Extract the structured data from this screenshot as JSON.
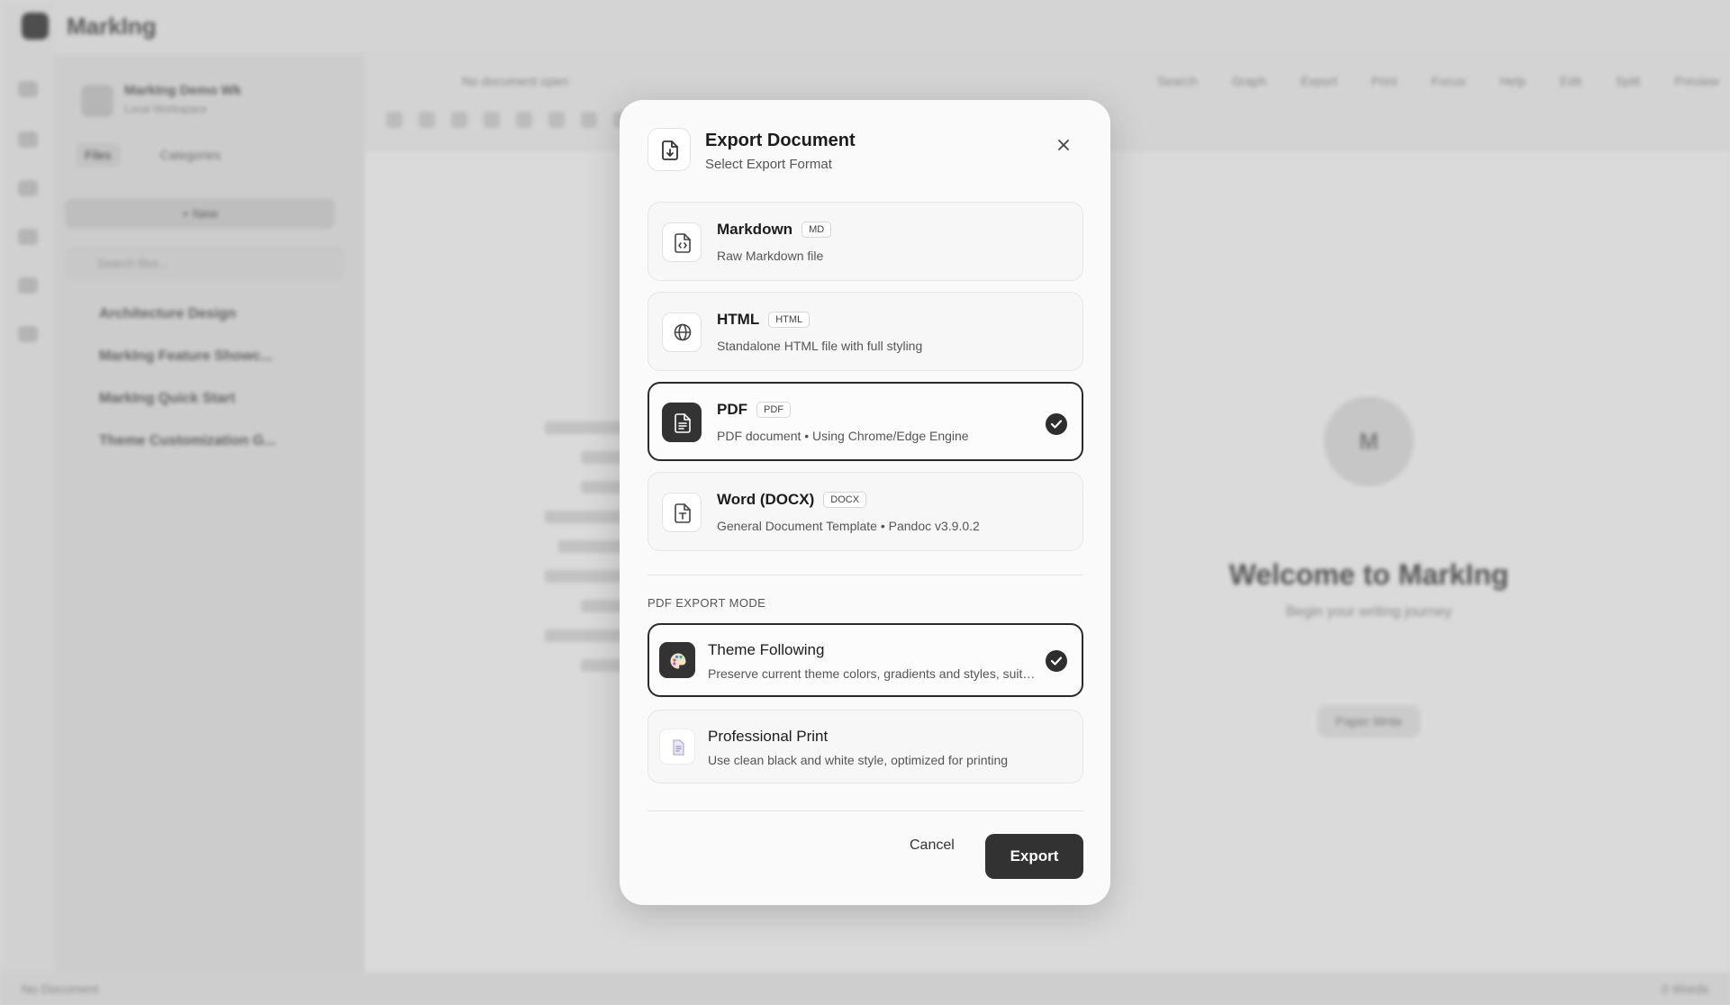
{
  "app": {
    "name": "MarkIng",
    "workspace_name": "MarkIng Demo Wk",
    "workspace_sub": "Local Workspace",
    "sidebar_tabs": [
      "Files",
      "Categories"
    ],
    "new_label": "+ New",
    "search_placeholder": "Search files...",
    "files": [
      "Architecture Design",
      "MarkIng Feature Showc...",
      "MarkIng Quick Start",
      "Theme Customization G..."
    ],
    "doc_title": "No document open",
    "toolbar_right": [
      "Search",
      "Graph",
      "Export",
      "Print",
      "Focus",
      "Help",
      "Edit",
      "Split",
      "Preview"
    ],
    "welcome_title": "Welcome to MarkIng",
    "welcome_sub": "Begin your writing journey",
    "welcome_button": "Paper Write",
    "status_left": "No Document",
    "status_right": "0 Words"
  },
  "dialog": {
    "title": "Export Document",
    "subtitle": "Select Export Format",
    "formats": [
      {
        "name": "Markdown",
        "badge": "MD",
        "desc": "Raw Markdown file",
        "icon": "markdown-file-icon",
        "selected": false
      },
      {
        "name": "HTML",
        "badge": "HTML",
        "desc": "Standalone HTML file with full styling",
        "icon": "globe-icon",
        "selected": false
      },
      {
        "name": "PDF",
        "badge": "PDF",
        "desc": "PDF document • Using Chrome/Edge Engine",
        "icon": "pdf-document-icon",
        "selected": true
      },
      {
        "name": "Word (DOCX)",
        "badge": "DOCX",
        "desc": "General Document Template • Pandoc v3.9.0.2",
        "icon": "word-document-icon",
        "selected": false
      }
    ],
    "pdf_mode_label": "PDF EXPORT MODE",
    "modes": [
      {
        "name": "Theme Following",
        "desc": "Preserve current theme colors, gradients and styles, suitable for screen reading",
        "icon": "palette-icon",
        "selected": true
      },
      {
        "name": "Professional Print",
        "desc": "Use clean black and white style, optimized for printing",
        "icon": "print-document-icon",
        "selected": false
      }
    ],
    "cancel_label": "Cancel",
    "export_label": "Export"
  },
  "colors": {
    "accent_dark": "#323232",
    "modal_bg": "#fafafa",
    "selected_border": "#2a2a2a"
  }
}
